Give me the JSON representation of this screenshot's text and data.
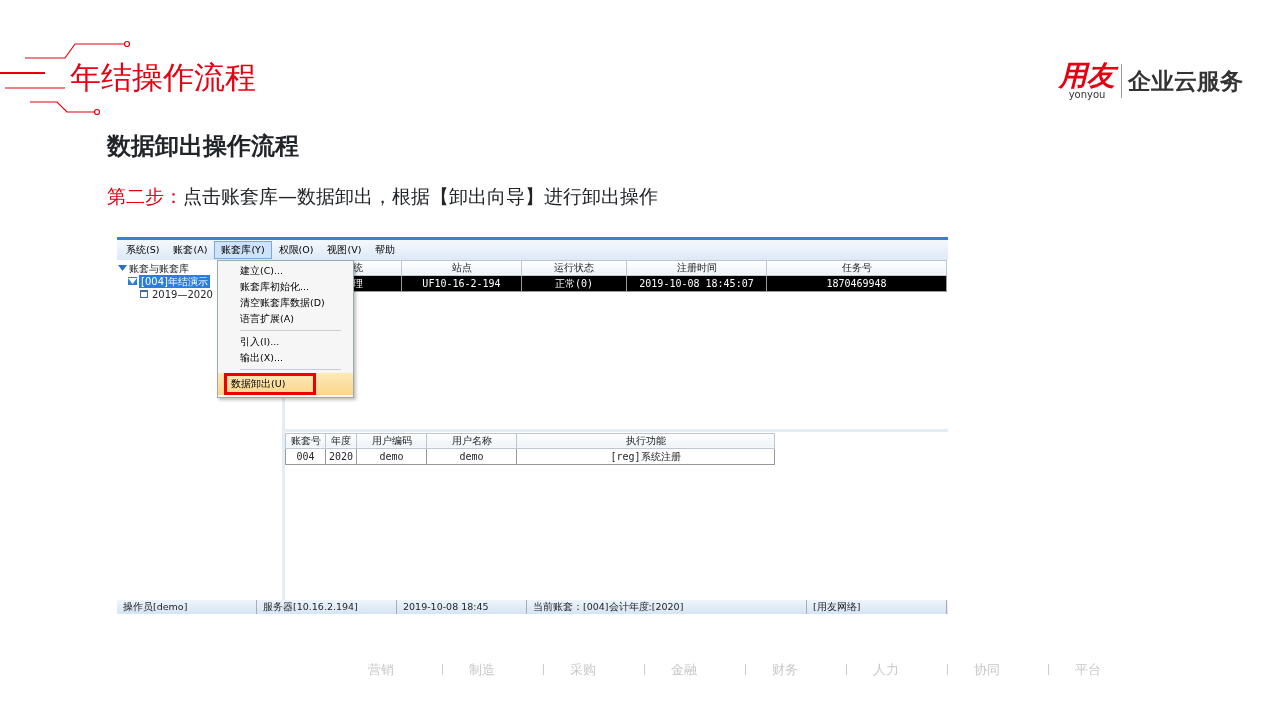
{
  "slide": {
    "title": "年结操作流程",
    "logo": {
      "mark": "用友",
      "sub": "yonyou",
      "tagline": "企业云服务"
    },
    "heading": "数据卸出操作流程",
    "step": {
      "label": "第二步：",
      "text": "点击账套库—数据卸出，根据【卸出向导】进行卸出操作"
    }
  },
  "app": {
    "menubar": [
      {
        "label": "系统(S)",
        "selected": false
      },
      {
        "label": "账套(A)",
        "selected": false
      },
      {
        "label": "账套库(Y)",
        "selected": true
      },
      {
        "label": "权限(O)",
        "selected": false
      },
      {
        "label": "视图(V)",
        "selected": false
      },
      {
        "label": "帮助",
        "selected": false
      }
    ],
    "tree": [
      {
        "label": "账套与账套库",
        "expanded": true,
        "selected": false,
        "children": [
          {
            "label": "[004]年结演示",
            "expanded": true,
            "selected": true,
            "children": [
              {
                "label": "2019—2020",
                "selected": false
              }
            ]
          }
        ]
      }
    ],
    "dropdown": [
      {
        "kind": "item",
        "label": "建立(C)...",
        "highlighted": false
      },
      {
        "kind": "item",
        "label": "账套库初始化...",
        "highlighted": false
      },
      {
        "kind": "item",
        "label": "清空账套库数据(D)",
        "highlighted": false
      },
      {
        "kind": "item",
        "label": "语言扩展(A)",
        "highlighted": false
      },
      {
        "kind": "separator"
      },
      {
        "kind": "item",
        "label": "引入(I)...",
        "highlighted": false
      },
      {
        "kind": "item",
        "label": "输出(X)...",
        "highlighted": false
      },
      {
        "kind": "separator"
      },
      {
        "kind": "item",
        "label": "数据卸出(U)",
        "highlighted": true
      }
    ],
    "sessions": {
      "columns": [
        "统",
        "站点",
        "运行状态",
        "注册时间",
        "任务号"
      ],
      "rows": [
        {
          "cells": [
            "理",
            "UF10-16-2-194",
            "正常(0)",
            "2019-10-08 18:45:07",
            "1870469948"
          ],
          "selected": true
        }
      ]
    },
    "log": {
      "columns": [
        "账套号",
        "年度",
        "用户编码",
        "用户名称",
        "执行功能"
      ],
      "rows": [
        {
          "cells": [
            "004",
            "2020",
            "demo",
            "demo",
            "[reg]系统注册"
          ],
          "selected": false
        }
      ]
    },
    "status_bar": [
      "操作员[demo]",
      "服务器[10.16.2.194]",
      "2019-10-08 18:45",
      "当前账套：[004]会计年度:[2020]",
      "[用友网络]"
    ]
  },
  "footer_nav": [
    "营销",
    "制造",
    "采购",
    "金融",
    "财务",
    "人力",
    "协同",
    "平台"
  ]
}
